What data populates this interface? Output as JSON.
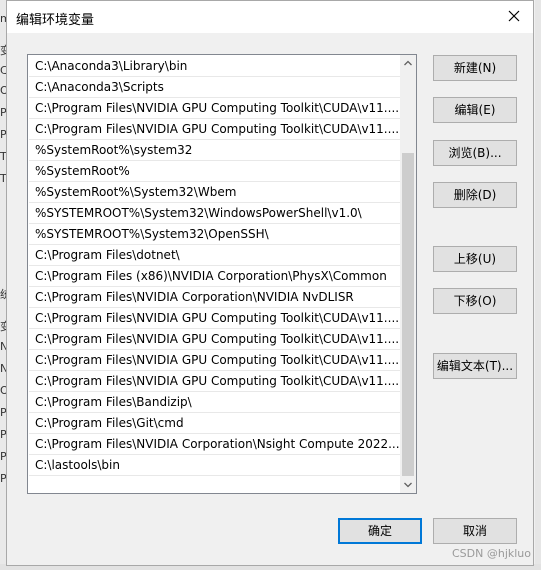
{
  "dialog": {
    "title": "编辑环境变量"
  },
  "paths": [
    "C:\\Anaconda3\\Library\\bin",
    "C:\\Anaconda3\\Scripts",
    "C:\\Program Files\\NVIDIA GPU Computing Toolkit\\CUDA\\v11....",
    "C:\\Program Files\\NVIDIA GPU Computing Toolkit\\CUDA\\v11....",
    "%SystemRoot%\\system32",
    "%SystemRoot%",
    "%SystemRoot%\\System32\\Wbem",
    "%SYSTEMROOT%\\System32\\WindowsPowerShell\\v1.0\\",
    "%SYSTEMROOT%\\System32\\OpenSSH\\",
    "C:\\Program Files\\dotnet\\",
    "C:\\Program Files (x86)\\NVIDIA Corporation\\PhysX\\Common",
    "C:\\Program Files\\NVIDIA Corporation\\NVIDIA NvDLISR",
    "C:\\Program Files\\NVIDIA GPU Computing Toolkit\\CUDA\\v11....",
    "C:\\Program Files\\NVIDIA GPU Computing Toolkit\\CUDA\\v11....",
    "C:\\Program Files\\NVIDIA GPU Computing Toolkit\\CUDA\\v11....",
    "C:\\Program Files\\NVIDIA GPU Computing Toolkit\\CUDA\\v11....",
    "C:\\Program Files\\Bandizip\\",
    "C:\\Program Files\\Git\\cmd",
    "C:\\Program Files\\NVIDIA Corporation\\Nsight Compute 2022....",
    "C:\\lastools\\bin"
  ],
  "buttons": {
    "new": "新建(N)",
    "edit": "编辑(E)",
    "browse": "浏览(B)...",
    "delete": "删除(D)",
    "move_up": "上移(U)",
    "move_down": "下移(O)",
    "edit_text": "编辑文本(T)...",
    "ok": "确定",
    "cancel": "取消"
  },
  "background_fragments": [
    "m",
    "变",
    "C",
    "O",
    "Pa",
    "Py",
    "TE",
    "TM",
    "统",
    "变",
    "N",
    "N",
    "O",
    "Pa",
    "PA",
    "PF",
    "PF"
  ],
  "watermark": "CSDN @hjkluo",
  "colors": {
    "default_button_border": "#0078d7",
    "list_border": "#828790"
  },
  "icons": [
    "close-icon",
    "scroll-up-arrow-icon",
    "scroll-down-arrow-icon"
  ]
}
